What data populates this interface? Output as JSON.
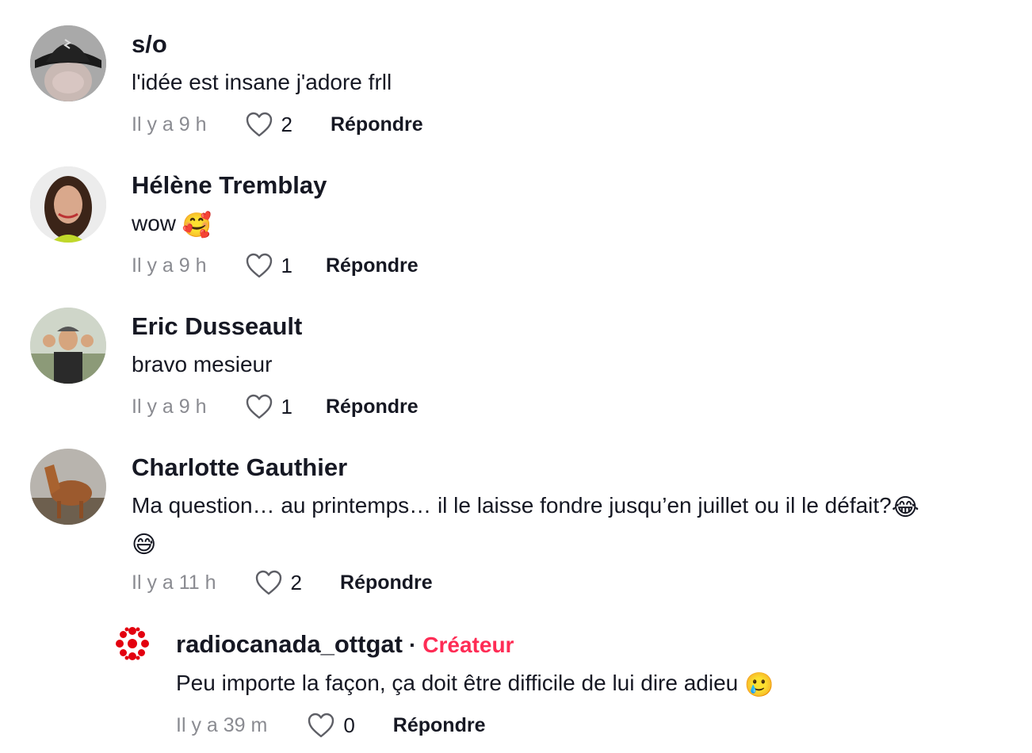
{
  "colors": {
    "creator_badge": "#fe2c55",
    "meta_gray": "#8a8b91",
    "text": "#161823"
  },
  "comments": [
    {
      "username": "s/o",
      "text": "l'idée est insane j'adore frll",
      "time": "Il y a 9 h",
      "likes": "2",
      "reply_label": "Répondre",
      "avatar_icon": "hat-avatar"
    },
    {
      "username": "Hélène Tremblay",
      "text": "wow",
      "emoji": "🥰",
      "time": "Il y a 9 h",
      "likes": "1",
      "reply_label": "Répondre",
      "avatar_icon": "woman-avatar"
    },
    {
      "username": "Eric Dusseault",
      "text": "bravo mesieur",
      "time": "Il y a 9 h",
      "likes": "1",
      "reply_label": "Répondre",
      "avatar_icon": "man-cap-avatar"
    },
    {
      "username": "Charlotte Gauthier",
      "text": "Ma question… au printemps… il le laisse fondre jusqu’en juillet ou il le défait?",
      "emoji": "😂",
      "emoji2": "😅",
      "time": "Il y a 11 h",
      "likes": "2",
      "reply_label": "Répondre",
      "avatar_icon": "horse-avatar"
    }
  ],
  "reply": {
    "username": "radiocanada_ottgat",
    "separator": "·",
    "badge": "Créateur",
    "text": "Peu importe la façon, ça doit être difficile de lui dire adieu",
    "emoji": "🥲",
    "time": "Il y a 39 m",
    "likes": "0",
    "reply_label": "Répondre",
    "avatar_icon": "radio-canada-logo"
  }
}
